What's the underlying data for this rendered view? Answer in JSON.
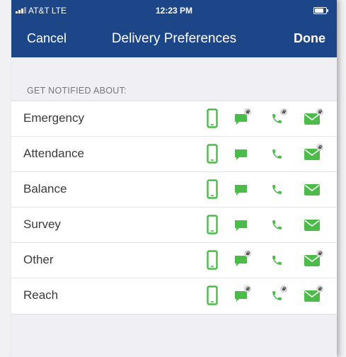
{
  "status_bar": {
    "carrier": "AT&T  LTE",
    "time": "12:23 PM"
  },
  "nav": {
    "cancel_label": "Cancel",
    "title": "Delivery Preferences",
    "done_label": "Done"
  },
  "section_header": "GET NOTIFIED ABOUT:",
  "colors": {
    "nav_bar": "#1c4688",
    "icon_green": "#4cbb4a"
  },
  "channel_icons": [
    "mobile-device-icon",
    "sms-chat-icon",
    "phone-call-icon",
    "email-envelope-icon"
  ],
  "rows": [
    {
      "label": "Emergency",
      "sms_locked": true,
      "voice_locked": true,
      "email_locked": true
    },
    {
      "label": "Attendance",
      "sms_locked": false,
      "voice_locked": false,
      "email_locked": true
    },
    {
      "label": "Balance",
      "sms_locked": false,
      "voice_locked": false,
      "email_locked": false
    },
    {
      "label": "Survey",
      "sms_locked": false,
      "voice_locked": false,
      "email_locked": false
    },
    {
      "label": "Other",
      "sms_locked": true,
      "voice_locked": false,
      "email_locked": true
    },
    {
      "label": "Reach",
      "sms_locked": true,
      "voice_locked": true,
      "email_locked": true
    }
  ]
}
